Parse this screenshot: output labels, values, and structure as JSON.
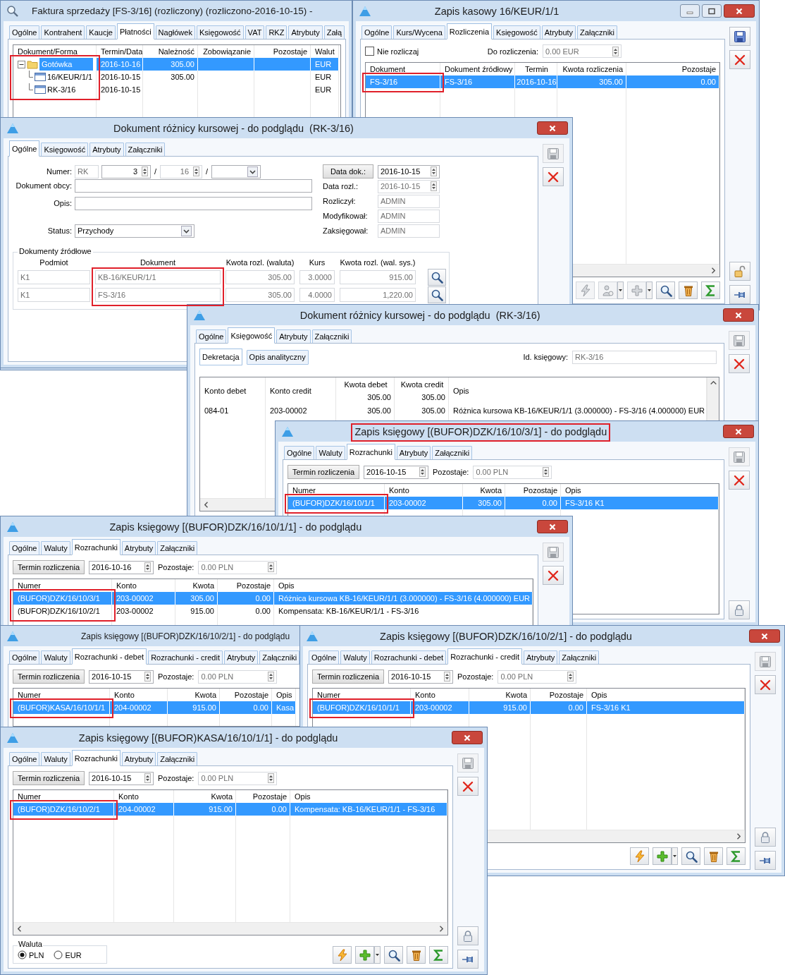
{
  "windows": [
    {
      "kind": "preview",
      "title": "Faktura sprzedaży [FS-3/16] (rozliczony) (rozliczono-2016-10-15) -",
      "tabs": [
        {
          "label": "Ogólne",
          "selected": false
        },
        {
          "label": "Kontrahent",
          "selected": false
        },
        {
          "label": "Kaucje",
          "selected": false
        },
        {
          "label": "Płatności",
          "selected": true
        },
        {
          "label": "Nagłówek",
          "selected": false
        },
        {
          "label": "Księgowość",
          "selected": false
        },
        {
          "label": "VAT",
          "selected": false
        },
        {
          "label": "RKZ",
          "selected": false
        },
        {
          "label": "Atrybuty",
          "selected": false
        },
        {
          "label": "Załą",
          "selected": false
        }
      ],
      "body": [
        {
          "kind": "tree_grid",
          "columns": [
            {
              "label": "Dokument/Forma",
              "kind": "text",
              "highlighted": true
            },
            {
              "label": "Termin/Data",
              "kind": "text"
            },
            {
              "label": "Należność",
              "kind": "number"
            },
            {
              "label": "Zobowiązanie",
              "kind": "number"
            },
            {
              "label": "Pozostaje",
              "kind": "number"
            },
            {
              "label": "Walut",
              "kind": "text"
            }
          ],
          "rows": [
            {
              "kind": "folder",
              "expanded": true,
              "selected": true,
              "cells": [
                "Gotówka",
                "2016-10-16",
                "305.00",
                null,
                null,
                "EUR"
              ],
              "children": [
                {
                  "kind": "document",
                  "selected": false,
                  "cells": [
                    "16/KEUR/1/1",
                    "2016-10-15",
                    "305.00",
                    null,
                    null,
                    "EUR"
                  ]
                },
                {
                  "kind": "document",
                  "selected": false,
                  "cells": [
                    "RK-3/16",
                    "2016-10-15",
                    null,
                    null,
                    null,
                    "EUR"
                  ]
                }
              ]
            }
          ]
        }
      ]
    },
    {
      "kind": "dialog",
      "title": "Zapis kasowy 16/KEUR/1/1",
      "minimize_button": true,
      "close_button": true,
      "tabs": [
        {
          "label": "Ogólne",
          "selected": false
        },
        {
          "label": "Kurs/Wycena",
          "selected": false
        },
        {
          "label": "Rozliczenia",
          "selected": true
        },
        {
          "label": "Księgowość",
          "selected": false
        },
        {
          "label": "Atrybuty",
          "selected": false
        },
        {
          "label": "Załączniki",
          "selected": false
        }
      ],
      "body": [
        {
          "kind": "settle_bar",
          "checkbox_label": "Nie rozliczaj",
          "checked": false,
          "label": "Do rozliczenia:",
          "value": "0.00 EUR"
        },
        {
          "kind": "grid",
          "hscroll": true,
          "columns": [
            {
              "label": "Dokument",
              "kind": "text",
              "highlighted": true
            },
            {
              "label": "Dokument źródłowy",
              "kind": "text"
            },
            {
              "label": "Termin",
              "kind": "date"
            },
            {
              "label": "Kwota rozliczenia",
              "kind": "number"
            },
            {
              "label": "Pozostaje",
              "kind": "number"
            }
          ],
          "rows": [
            {
              "selected": true,
              "cells": [
                "FS-3/16",
                "FS-3/16",
                "2016-10-16",
                "305.00",
                "0.00"
              ]
            }
          ]
        },
        {
          "kind": "footer",
          "buttons": [
            {
              "kind": "lightning",
              "disabled": true
            },
            {
              "kind": "person",
              "disabled": true,
              "dropdown": true
            },
            {
              "kind": "plus",
              "disabled": true,
              "dropdown": true
            },
            {
              "kind": "search"
            },
            {
              "kind": "trash"
            },
            {
              "kind": "sigma"
            }
          ]
        }
      ],
      "side": [
        {
          "kind": "save"
        },
        {
          "kind": "delete"
        }
      ],
      "side_bottom": [
        {
          "kind": "lock_open"
        },
        {
          "kind": "pin"
        }
      ]
    },
    {
      "kind": "dialog",
      "title": "Dokument różnicy kursowej - do podglądu  (RK-3/16)",
      "close_button": true,
      "tabs": [
        {
          "label": "Ogólne",
          "selected": true
        },
        {
          "label": "Księgowość",
          "selected": false
        },
        {
          "label": "Atrybuty",
          "selected": false
        },
        {
          "label": "Załączniki",
          "selected": false
        }
      ],
      "body": [
        {
          "kind": "doc_form",
          "left": [
            {
              "label": "Numer:",
              "fields": [
                {
                  "kind": "text",
                  "value": "RK",
                  "disabled": true
                },
                {
                  "kind": "spin",
                  "value": "3"
                },
                {
                  "kind": "sep",
                  "text": "/"
                },
                {
                  "kind": "spin",
                  "value": "16",
                  "disabled": true
                },
                {
                  "kind": "sep",
                  "text": "/"
                },
                {
                  "kind": "combo"
                }
              ]
            },
            {
              "label": "Dokument obcy:",
              "fields": [
                {
                  "kind": "text"
                }
              ]
            },
            {
              "label": "Opis:",
              "fields": [
                {
                  "kind": "text"
                }
              ]
            },
            {
              "label": "Status:",
              "fields": [
                {
                  "kind": "combo",
                  "value": "Przychody"
                }
              ]
            }
          ],
          "right": [
            {
              "label": "Data dok.:",
              "label_button": true,
              "field": {
                "kind": "date",
                "value": "2016-10-15"
              }
            },
            {
              "label": "Data rozl.:",
              "field": {
                "kind": "date",
                "value": "2016-10-15",
                "disabled": true
              }
            },
            {
              "label": "Rozliczył:",
              "field": {
                "kind": "text",
                "value": "ADMIN",
                "disabled": true
              }
            },
            {
              "label": "Modyfikował:",
              "field": {
                "kind": "text",
                "value": "ADMIN",
                "disabled": true
              }
            },
            {
              "label": "Zaksięgował:",
              "field": {
                "kind": "text",
                "value": "ADMIN",
                "disabled": true
              }
            }
          ]
        },
        {
          "kind": "source_group",
          "title": "Dokumenty źródłowe",
          "columns": [
            {
              "label": "Podmiot"
            },
            {
              "label": "Dokument",
              "highlighted": true
            },
            {
              "label": "Kwota rozl. (waluta)"
            },
            {
              "label": "Kurs"
            },
            {
              "label": "Kwota rozl. (wal. sys.)"
            }
          ],
          "rows": [
            {
              "cells": [
                "K1",
                "KB-16/KEUR/1/1",
                "305.00",
                "3.0000",
                "915.00"
              ],
              "lookup_button": true
            },
            {
              "cells": [
                "K1",
                "FS-3/16",
                "305.00",
                "4.0000",
                "1,220.00"
              ],
              "lookup_button": true
            }
          ]
        }
      ],
      "side": [
        {
          "kind": "save",
          "disabled": true
        },
        {
          "kind": "delete"
        }
      ]
    },
    {
      "kind": "dialog",
      "title": "Dokument różnicy kursowej - do podglądu  (RK-3/16)",
      "close_button": true,
      "tabs": [
        {
          "label": "Ogólne",
          "selected": false
        },
        {
          "label": "Księgowość",
          "selected": true
        },
        {
          "label": "Atrybuty",
          "selected": false
        },
        {
          "label": "Załączniki",
          "selected": false
        }
      ],
      "body": [
        {
          "kind": "subtabs",
          "tabs": [
            {
              "label": "Dekretacja",
              "selected": true
            },
            {
              "label": "Opis analityczny",
              "selected": false
            }
          ],
          "label": "Id. księgowy:",
          "value": "RK-3/16"
        },
        {
          "kind": "grid",
          "hscroll": true,
          "vscroll": true,
          "columns": [
            {
              "label": "Konto debet",
              "kind": "text"
            },
            {
              "label": "Konto credit",
              "kind": "text"
            },
            {
              "label": "Kwota debet",
              "kind": "number",
              "total": "305.00"
            },
            {
              "label": "Kwota credit",
              "kind": "number",
              "total": "305.00"
            },
            {
              "label": "Opis",
              "kind": "text"
            }
          ],
          "rows": [
            {
              "selected": false,
              "cells": [
                "084-01",
                "203-00002",
                "305.00",
                "305.00",
                "Różnica kursowa KB-16/KEUR/1/1 (3.000000) - FS-3/16 (4.000000) EUR"
              ]
            }
          ]
        }
      ],
      "side": [
        {
          "kind": "save",
          "disabled": true
        },
        {
          "kind": "delete"
        }
      ]
    },
    {
      "kind": "dialog",
      "title": "Zapis księgowy [(BUFOR)DZK/16/10/3/1] - do podglądu",
      "close_button": true,
      "title_highlighted": true,
      "tabs": [
        {
          "label": "Ogólne",
          "selected": false
        },
        {
          "label": "Waluty",
          "selected": false
        },
        {
          "label": "Rozrachunki",
          "selected": true
        },
        {
          "label": "Atrybuty",
          "selected": false
        },
        {
          "label": "Załączniki",
          "selected": false
        }
      ],
      "body": [
        {
          "kind": "term_bar",
          "button": "Termin rozliczenia",
          "date": "2016-10-15",
          "label": "Pozostaje:",
          "value": "0.00 PLN"
        },
        {
          "kind": "grid",
          "columns": [
            {
              "label": "Numer",
              "kind": "text",
              "highlighted": true
            },
            {
              "label": "Konto",
              "kind": "text"
            },
            {
              "label": "Kwota",
              "kind": "number"
            },
            {
              "label": "Pozostaje",
              "kind": "number"
            },
            {
              "label": "Opis",
              "kind": "text"
            }
          ],
          "rows": [
            {
              "selected": true,
              "cells": [
                "(BUFOR)DZK/16/10/1/1",
                "203-00002",
                "305.00",
                "0.00",
                "FS-3/16 K1"
              ]
            }
          ]
        }
      ],
      "side": [
        {
          "kind": "save",
          "disabled": true
        },
        {
          "kind": "delete"
        }
      ],
      "side_bottom": [
        {
          "kind": "lock"
        }
      ]
    },
    {
      "kind": "dialog",
      "title": "Zapis księgowy [(BUFOR)DZK/16/10/1/1] - do podglądu",
      "close_button": true,
      "tabs": [
        {
          "label": "Ogólne",
          "selected": false
        },
        {
          "label": "Waluty",
          "selected": false
        },
        {
          "label": "Rozrachunki",
          "selected": true
        },
        {
          "label": "Atrybuty",
          "selected": false
        },
        {
          "label": "Załączniki",
          "selected": false
        }
      ],
      "body": [
        {
          "kind": "term_bar",
          "button": "Termin rozliczenia",
          "date": "2016-10-16",
          "label": "Pozostaje:",
          "value": "0.00 PLN"
        },
        {
          "kind": "grid",
          "columns": [
            {
              "label": "Numer",
              "kind": "text",
              "highlighted": true
            },
            {
              "label": "Konto",
              "kind": "text"
            },
            {
              "label": "Kwota",
              "kind": "number"
            },
            {
              "label": "Pozostaje",
              "kind": "number"
            },
            {
              "label": "Opis",
              "kind": "text"
            }
          ],
          "rows": [
            {
              "selected": true,
              "cells": [
                "(BUFOR)DZK/16/10/3/1",
                "203-00002",
                "305.00",
                "0.00",
                "Różnica kursowa KB-16/KEUR/1/1 (3.000000) - FS-3/16 (4.000000) EUR"
              ]
            },
            {
              "selected": false,
              "cells": [
                "(BUFOR)DZK/16/10/2/1",
                "203-00002",
                "915.00",
                "0.00",
                "Kompensata: KB-16/KEUR/1/1 - FS-3/16"
              ]
            }
          ]
        }
      ],
      "side": [
        {
          "kind": "save",
          "disabled": true
        },
        {
          "kind": "delete"
        }
      ]
    },
    {
      "kind": "dialog",
      "title": "Zapis księgowy [(BUFOR)DZK/16/10/2/1] - do podglądu",
      "tabs": [
        {
          "label": "Ogólne",
          "selected": false
        },
        {
          "label": "Waluty",
          "selected": false
        },
        {
          "label": "Rozrachunki - debet",
          "selected": true
        },
        {
          "label": "Rozrachunki - credit",
          "selected": false
        },
        {
          "label": "Atrybuty",
          "selected": false
        },
        {
          "label": "Załączniki",
          "selected": false
        }
      ],
      "body": [
        {
          "kind": "term_bar",
          "button": "Termin rozliczenia",
          "date": "2016-10-15",
          "label": "Pozostaje:",
          "value": "0.00 PLN"
        },
        {
          "kind": "grid",
          "columns": [
            {
              "label": "Numer",
              "kind": "text",
              "highlighted": true
            },
            {
              "label": "Konto",
              "kind": "text"
            },
            {
              "label": "Kwota",
              "kind": "number"
            },
            {
              "label": "Pozostaje",
              "kind": "number"
            },
            {
              "label": "Opis",
              "kind": "text"
            }
          ],
          "rows": [
            {
              "selected": true,
              "cells": [
                "(BUFOR)KASA/16/10/1/1",
                "204-00002",
                "915.00",
                "0.00",
                "Kasa"
              ]
            }
          ]
        }
      ]
    },
    {
      "kind": "dialog",
      "title": "Zapis księgowy [(BUFOR)DZK/16/10/2/1] - do podglądu",
      "close_button": true,
      "tabs": [
        {
          "label": "Ogólne",
          "selected": false
        },
        {
          "label": "Waluty",
          "selected": false
        },
        {
          "label": "Rozrachunki - debet",
          "selected": false
        },
        {
          "label": "Rozrachunki - credit",
          "selected": true
        },
        {
          "label": "Atrybuty",
          "selected": false
        },
        {
          "label": "Załączniki",
          "selected": false
        }
      ],
      "body": [
        {
          "kind": "term_bar",
          "button": "Termin rozliczenia",
          "date": "2016-10-15",
          "label": "Pozostaje:",
          "value": "0.00 PLN"
        },
        {
          "kind": "grid",
          "hscroll": true,
          "columns": [
            {
              "label": "Numer",
              "kind": "text",
              "highlighted": true
            },
            {
              "label": "Konto",
              "kind": "text"
            },
            {
              "label": "Kwota",
              "kind": "number"
            },
            {
              "label": "Pozostaje",
              "kind": "number"
            },
            {
              "label": "Opis",
              "kind": "text"
            }
          ],
          "rows": [
            {
              "selected": true,
              "cells": [
                "(BUFOR)DZK/16/10/1/1",
                "203-00002",
                "915.00",
                "0.00",
                "FS-3/16 K1"
              ]
            }
          ]
        },
        {
          "kind": "footer",
          "buttons": [
            {
              "kind": "lightning"
            },
            {
              "kind": "plus",
              "dropdown": true
            },
            {
              "kind": "search"
            },
            {
              "kind": "trash"
            },
            {
              "kind": "sigma"
            }
          ]
        }
      ],
      "side": [
        {
          "kind": "save",
          "disabled": true
        },
        {
          "kind": "delete"
        }
      ],
      "side_bottom": [
        {
          "kind": "lock"
        },
        {
          "kind": "pin"
        }
      ]
    },
    {
      "kind": "dialog",
      "title": "Zapis księgowy [(BUFOR)KASA/16/10/1/1] - do podglądu",
      "close_button": true,
      "tabs": [
        {
          "label": "Ogólne",
          "selected": false
        },
        {
          "label": "Waluty",
          "selected": false
        },
        {
          "label": "Rozrachunki",
          "selected": true
        },
        {
          "label": "Atrybuty",
          "selected": false
        },
        {
          "label": "Załączniki",
          "selected": false
        }
      ],
      "body": [
        {
          "kind": "term_bar",
          "button": "Termin rozliczenia",
          "date": "2016-10-15",
          "label": "Pozostaje:",
          "value": "0.00 PLN"
        },
        {
          "kind": "grid",
          "hscroll": true,
          "columns": [
            {
              "label": "Numer",
              "kind": "text",
              "highlighted": true
            },
            {
              "label": "Konto",
              "kind": "text"
            },
            {
              "label": "Kwota",
              "kind": "number"
            },
            {
              "label": "Pozostaje",
              "kind": "number"
            },
            {
              "label": "Opis",
              "kind": "text"
            }
          ],
          "rows": [
            {
              "selected": true,
              "cells": [
                "(BUFOR)DZK/16/10/2/1",
                "204-00002",
                "915.00",
                "0.00",
                "Kompensata: KB-16/KEUR/1/1 - FS-3/16"
              ]
            }
          ]
        },
        {
          "kind": "footer",
          "group": {
            "title": "Waluta",
            "options": [
              {
                "label": "PLN",
                "selected": true
              },
              {
                "label": "EUR",
                "selected": false
              }
            ]
          },
          "buttons": [
            {
              "kind": "lightning"
            },
            {
              "kind": "plus",
              "dropdown": true
            },
            {
              "kind": "search"
            },
            {
              "kind": "trash"
            },
            {
              "kind": "sigma"
            }
          ]
        }
      ],
      "side": [
        {
          "kind": "save",
          "disabled": true
        },
        {
          "kind": "delete"
        }
      ],
      "side_bottom": [
        {
          "kind": "lock"
        },
        {
          "kind": "pin"
        }
      ]
    }
  ]
}
